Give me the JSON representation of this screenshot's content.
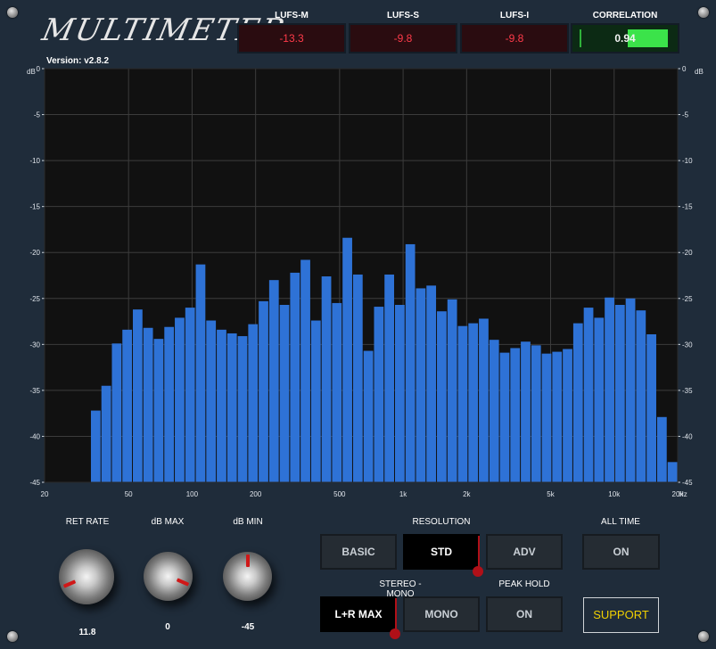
{
  "app": {
    "title": "MULTIMETER",
    "version": "Version: v2.8.2"
  },
  "meters": [
    {
      "label": "LUFS-M",
      "value": "-13.3"
    },
    {
      "label": "LUFS-S",
      "value": "-9.8"
    },
    {
      "label": "LUFS-I",
      "value": "-9.8"
    }
  ],
  "correlation": {
    "label": "CORRELATION",
    "value": "0.94",
    "level": 0.94,
    "bar_color": "#3be34a"
  },
  "chart_units": {
    "left": "dB",
    "right": "dB",
    "x": "Hz"
  },
  "chart_data": {
    "type": "bar",
    "xlabel": "Hz",
    "ylabel": "dB",
    "xscale": "log",
    "xlim": [
      20,
      20000
    ],
    "ylim": [
      -45,
      0
    ],
    "grid": true,
    "bar_color": "#2e72d6",
    "yticks": [
      "0",
      "-5",
      "-10",
      "-15",
      "-20",
      "-25",
      "-30",
      "-35",
      "-40",
      "-45"
    ],
    "xticks": [
      {
        "value": 20,
        "label": "20"
      },
      {
        "value": 50,
        "label": "50"
      },
      {
        "value": 100,
        "label": "100"
      },
      {
        "value": 200,
        "label": "200"
      },
      {
        "value": 500,
        "label": "500"
      },
      {
        "value": 1000,
        "label": "1k"
      },
      {
        "value": 2000,
        "label": "2k"
      },
      {
        "value": 5000,
        "label": "5k"
      },
      {
        "value": 10000,
        "label": "10k"
      },
      {
        "value": 20000,
        "label": "20k"
      }
    ],
    "values": [
      -37.2,
      -34.5,
      -29.9,
      -28.4,
      -26.2,
      -28.2,
      -29.4,
      -28.1,
      -27.1,
      -26.0,
      -21.3,
      -27.4,
      -28.4,
      -28.8,
      -29.1,
      -27.8,
      -25.3,
      -23.0,
      -25.7,
      -22.2,
      -20.8,
      -27.4,
      -22.6,
      -25.5,
      -18.4,
      -22.4,
      -30.7,
      -25.9,
      -22.4,
      -25.7,
      -19.1,
      -23.9,
      -23.6,
      -26.4,
      -25.1,
      -28.0,
      -27.7,
      -27.2,
      -29.5,
      -30.9,
      -30.4,
      -29.7,
      -30.1,
      -31.0,
      -30.8,
      -30.5,
      -27.7,
      -26.0,
      -27.1,
      -24.9,
      -25.7,
      -25.0,
      -26.3,
      -28.9,
      -37.9,
      -42.8
    ]
  },
  "controls": {
    "knobs": [
      {
        "label": "RET RATE",
        "value": "11.8",
        "level": 0.08
      },
      {
        "label": "dB MAX",
        "value": "0",
        "level": 0.92
      },
      {
        "label": "dB MIN",
        "value": "-45",
        "level": 0.5
      }
    ],
    "resolution": {
      "label": "RESOLUTION",
      "options": [
        "BASIC",
        "STD",
        "ADV"
      ],
      "selected": "STD"
    },
    "all_time": {
      "label": "ALL TIME",
      "button": "ON"
    },
    "stereo_mono": {
      "label": "STEREO - MONO",
      "options": [
        "L+R MAX",
        "MONO"
      ],
      "selected": "L+R MAX"
    },
    "peak_hold": {
      "label": "PEAK HOLD",
      "button": "ON"
    },
    "support": "SUPPORT"
  },
  "colors": {
    "background": "#1f2c3a",
    "plot": "#111111",
    "meter_text": "#ff3b4a",
    "accent": "#b01018",
    "support_text": "#f0d000"
  }
}
